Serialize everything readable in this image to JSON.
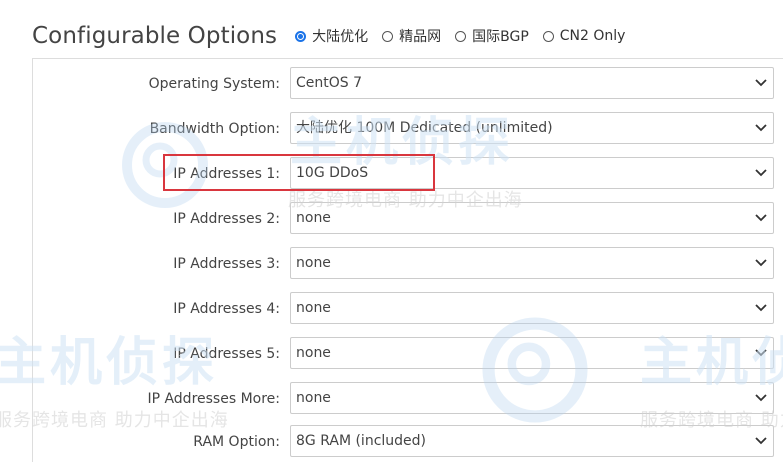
{
  "header": {
    "title": "Configurable Options",
    "radio_options": [
      {
        "label": "大陆优化",
        "checked": true
      },
      {
        "label": "精品网",
        "checked": false
      },
      {
        "label": "国际BGP",
        "checked": false
      },
      {
        "label": "CN2 Only",
        "checked": false
      }
    ]
  },
  "options": [
    {
      "label": "Operating System:",
      "value": "CentOS 7"
    },
    {
      "label": "Bandwidth Option:",
      "value": "大陆优化 100M Dedicated (unlimited)"
    },
    {
      "label": "IP Addresses 1:",
      "value": "10G DDoS"
    },
    {
      "label": "IP Addresses 2:",
      "value": "none"
    },
    {
      "label": "IP Addresses 3:",
      "value": "none"
    },
    {
      "label": "IP Addresses 4:",
      "value": "none"
    },
    {
      "label": "IP Addresses 5:",
      "value": "none"
    },
    {
      "label": "IP Addresses More:",
      "value": "none"
    },
    {
      "label": "RAM Option:",
      "value": "8G RAM (included)"
    }
  ],
  "watermark": {
    "brand": "主机侦探",
    "slogan": "服务跨境电商 助力中企出海"
  },
  "colors": {
    "accent": "#1a73e8",
    "highlight": "#d9363e",
    "border": "#cccccc"
  }
}
